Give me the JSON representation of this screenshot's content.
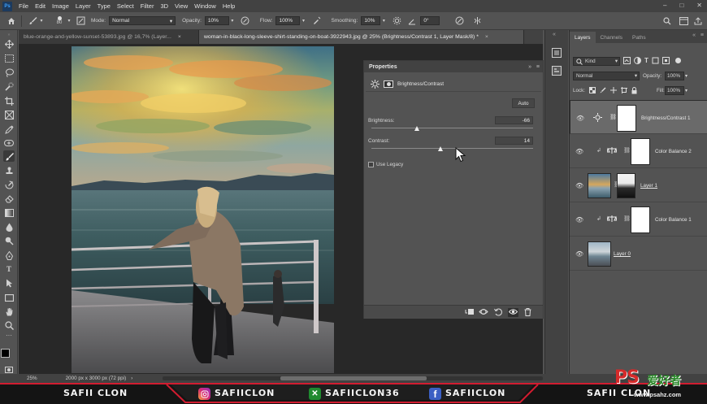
{
  "app": {
    "logo": "Ps"
  },
  "menu": [
    "File",
    "Edit",
    "Image",
    "Layer",
    "Type",
    "Select",
    "Filter",
    "3D",
    "View",
    "Window",
    "Help"
  ],
  "window_controls": [
    "–",
    "□",
    "✕"
  ],
  "options": {
    "brush_size": "80",
    "mode_label": "Mode:",
    "mode_value": "Normal",
    "opacity_label": "Opacity:",
    "opacity_value": "10%",
    "flow_label": "Flow:",
    "flow_value": "100%",
    "smoothing_label": "Smoothing:",
    "smoothing_value": "10%",
    "angle_value": "0°"
  },
  "tabs": [
    {
      "label": "blue-orange-and-yellow-sunset-53893.jpg @ 16,7% (Layer...",
      "close": "×"
    },
    {
      "label": "woman-in-black-long-sleeve-shirt-standing-on-boat-3922943.jpg @ 25% (Brightness/Contrast 1, Layer Mask/8) *",
      "close": "×"
    }
  ],
  "properties": {
    "title": "Properties",
    "adjustment": "Brightness/Contrast",
    "auto_label": "Auto",
    "brightness_label": "Brightness:",
    "brightness_value": "-66",
    "brightness_level": -66,
    "contrast_label": "Contrast:",
    "contrast_value": "14",
    "contrast_level": 14,
    "legacy_label": "Use Legacy"
  },
  "layers_panel": {
    "tabs": [
      "Layers",
      "Channels",
      "Paths"
    ],
    "kind_label": "Kind",
    "blend_mode": "Normal",
    "opacity_label": "Opacity:",
    "opacity_value": "100%",
    "lock_label": "Lock:",
    "fill_label": "Fill:",
    "fill_value": "100%",
    "layers": [
      {
        "name": "Brightness/Contrast 1"
      },
      {
        "name": "Color Balance 2"
      },
      {
        "name": "Layer 1"
      },
      {
        "name": "Color Balance 1"
      },
      {
        "name": "Layer 0"
      }
    ]
  },
  "status": {
    "zoom": "25%",
    "doc_size": "2000 px x 3000 px (72 ppi)"
  },
  "banner": {
    "left": "SAFII CLON",
    "instagram": "SAFIICLON",
    "xbox": "SAFIICLON36",
    "facebook": "SAFIICLON",
    "right": "SAFII CLON"
  },
  "watermark": {
    "brand": "PS",
    "cn": "爱好者",
    "url": "www.psahz.com"
  },
  "colors": {
    "accent": "#31a8ff",
    "banner_red": "#d21c30"
  }
}
